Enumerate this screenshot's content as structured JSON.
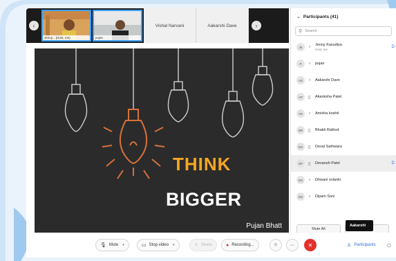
{
  "thumbnails": [
    {
      "type": "video",
      "caption": "Jenny...  (Host, me)"
    },
    {
      "type": "video",
      "caption": "pujan"
    },
    {
      "type": "name",
      "label": "Vishal Narvani"
    },
    {
      "type": "name",
      "label": "Aakarshi Dave"
    }
  ],
  "slide": {
    "line1": "THINK",
    "line2": "BIGGER",
    "presenter": "Pujan Bhatt"
  },
  "participants": {
    "title": "Participants (41)",
    "search_placeholder": "Search",
    "list": [
      {
        "initials": "JK",
        "mic": "mic",
        "name": "Jenny Kasudiya",
        "sub": "Host, me",
        "tag": "D"
      },
      {
        "initials": "P",
        "mic": "mic",
        "name": "pujan",
        "sub": "",
        "tag": ""
      },
      {
        "initials": "AD",
        "mic": "mic",
        "name": "Aakarshi Dave",
        "sub": "",
        "tag": ""
      },
      {
        "initials": "AP",
        "mic": "device",
        "name": "Akanksha Patel",
        "sub": "",
        "tag": ""
      },
      {
        "initials": "AK",
        "mic": "mic",
        "name": "Amisha koshti",
        "sub": "",
        "tag": ""
      },
      {
        "initials": "BR",
        "mic": "device",
        "name": "Bhakti Rathod",
        "sub": "",
        "tag": ""
      },
      {
        "initials": "DS",
        "mic": "device",
        "name": "Deval Sathwara",
        "sub": "",
        "tag": ""
      },
      {
        "initials": "DP",
        "mic": "device",
        "name": "Devansh Patel",
        "sub": "",
        "tag": "D"
      },
      {
        "initials": "DS",
        "mic": "mic",
        "name": "Dhwani solanki",
        "sub": "",
        "tag": ""
      },
      {
        "initials": "DS",
        "mic": "mic",
        "name": "Dipam Soni",
        "sub": "",
        "tag": ""
      }
    ],
    "mute_all": "Mute All",
    "unmute_all": "Unmu"
  },
  "tooltip": "Aakarshi",
  "toolbar": {
    "mute": "Mute",
    "stop_video": "Stop video",
    "share": "Share",
    "recording": "Recording...",
    "participants": "Participants"
  },
  "colors": {
    "accent_orange": "#f5a623",
    "slide_bg": "#2b2b2b",
    "end_red": "#e0312a",
    "link_blue": "#2f6fd9",
    "frame_blue": "#7fb9e6"
  }
}
